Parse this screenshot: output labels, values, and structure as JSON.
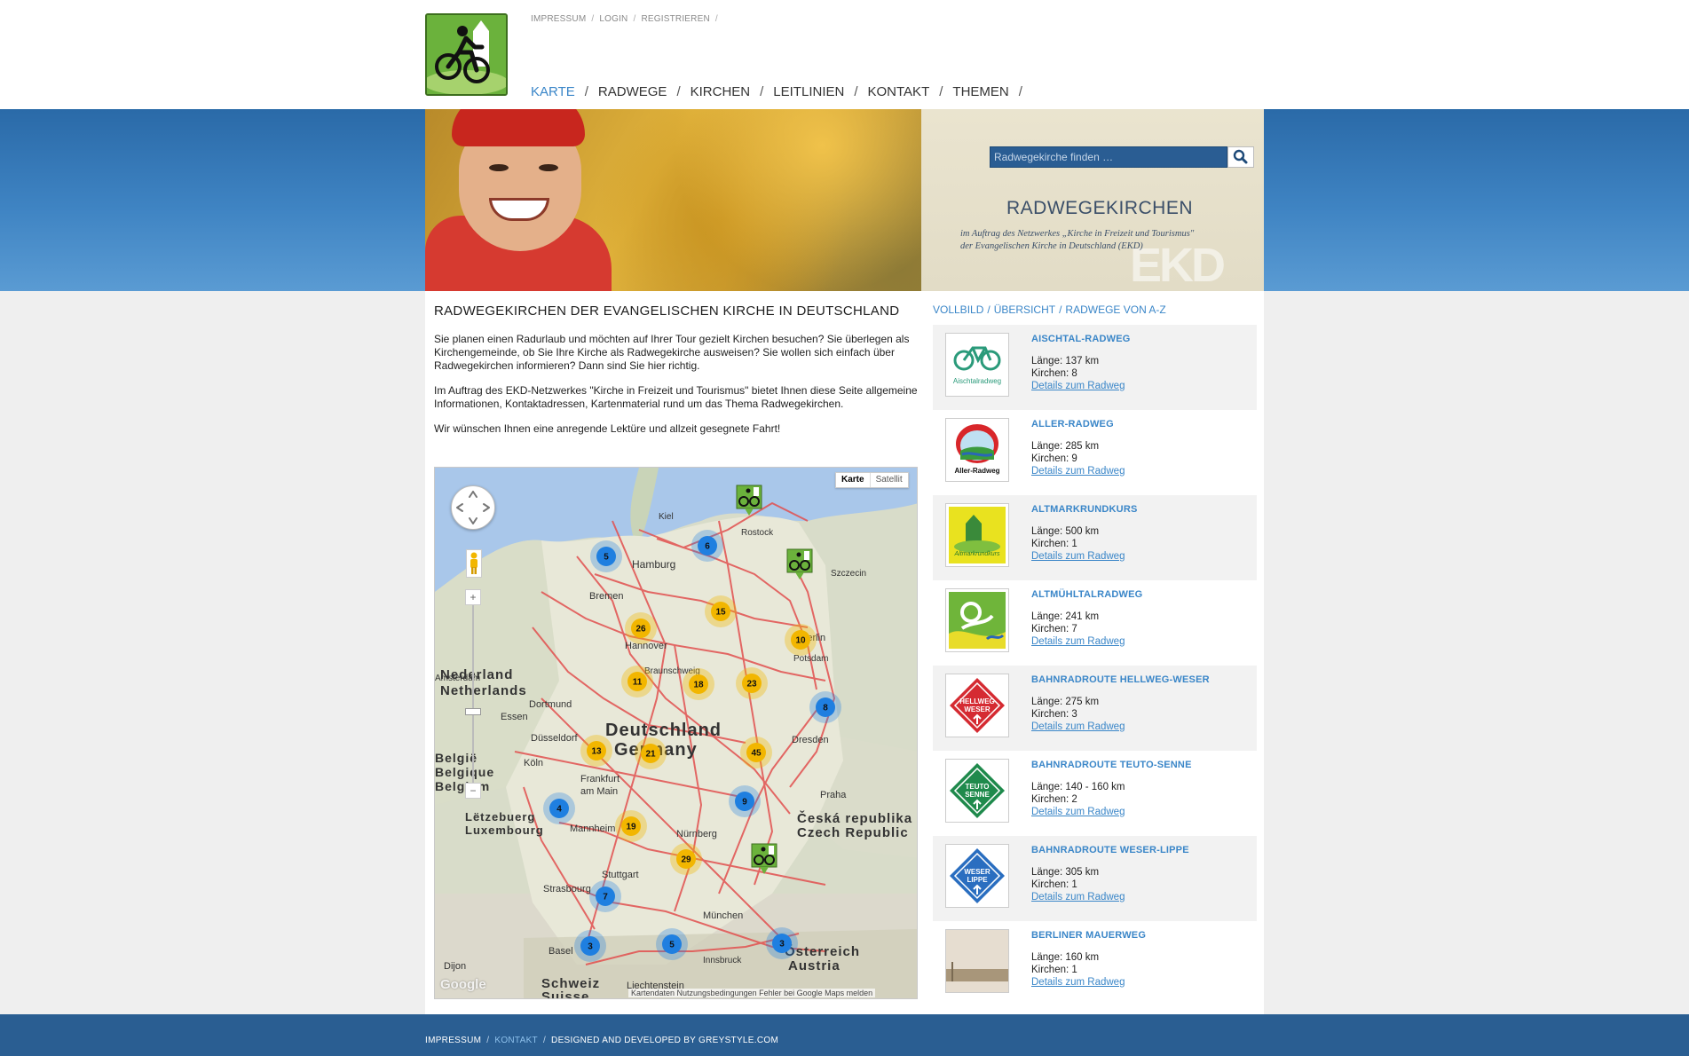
{
  "topnav": {
    "items": [
      {
        "label": "IMPRESSUM"
      },
      {
        "label": "LOGIN"
      },
      {
        "label": "REGISTRIEREN"
      }
    ],
    "separator": "/"
  },
  "mainnav": {
    "items": [
      {
        "label": "KARTE",
        "active": true
      },
      {
        "label": "RADWEGE"
      },
      {
        "label": "KIRCHEN"
      },
      {
        "label": "LEITLINIEN"
      },
      {
        "label": "KONTAKT"
      },
      {
        "label": "THEMEN"
      }
    ],
    "separator": "/"
  },
  "banner": {
    "search_placeholder": "Radwegekirche finden …",
    "title": "RADWEGEKIRCHEN",
    "subtitle_line1": "im Auftrag des Netzwerkes „Kirche in Freizeit und Tourismus\"",
    "subtitle_line2": "der Evangelischen Kirche in Deutschland (EKD)",
    "watermark": "EKD"
  },
  "intro": {
    "heading": "RADWEGEKIRCHEN DER EVANGELISCHEN KIRCHE IN DEUTSCHLAND",
    "p1": "Sie planen einen Radurlaub und möchten auf Ihrer Tour gezielt Kirchen besuchen? Sie überlegen als Kirchengemeinde, ob Sie Ihre Kirche als Radwegekirche ausweisen? Sie wollen sich einfach über Radwegekirchen informieren? Dann sind Sie hier richtig.",
    "p2": "Im Auftrag des EKD-Netzwerkes \"Kirche in Freizeit und Tourismus\" bietet Ihnen diese Seite allgemeine Informationen, Kontaktadressen, Kartenmaterial rund um das Thema Radwegekirchen.",
    "p3": "Wir wünschen Ihnen eine anregende Lektüre und allzeit gesegnete Fahrt!"
  },
  "map": {
    "type_buttons": {
      "karte": "Karte",
      "satellit": "Satellit"
    },
    "zoom_in": "+",
    "zoom_out": "−",
    "google": "Google",
    "footer": "Kartendaten   Nutzungsbedingungen   Fehler bei Google Maps melden",
    "labels": [
      {
        "text": "Kiel"
      },
      {
        "text": "Rostock"
      },
      {
        "text": "Hamburg"
      },
      {
        "text": "Szczecin"
      },
      {
        "text": "Bremen"
      },
      {
        "text": "Hannover"
      },
      {
        "text": "Berlin"
      },
      {
        "text": "Potsdam"
      },
      {
        "text": "Braunschweig"
      },
      {
        "text": "Nederland"
      },
      {
        "text": "Netherlands"
      },
      {
        "text": "Dortmund"
      },
      {
        "text": "Essen"
      },
      {
        "text": "Düsseldorf"
      },
      {
        "text": "Deutschland"
      },
      {
        "text": "Germany"
      },
      {
        "text": "Dresden"
      },
      {
        "text": "Köln"
      },
      {
        "text": "België"
      },
      {
        "text": "Belgique"
      },
      {
        "text": "Belgium"
      },
      {
        "text": "Frankfurt"
      },
      {
        "text": "am Main"
      },
      {
        "text": "Praha"
      },
      {
        "text": "Lëtzebuerg"
      },
      {
        "text": "Luxembourg"
      },
      {
        "text": "Mannheim"
      },
      {
        "text": "Nürnberg"
      },
      {
        "text": "Česká republika"
      },
      {
        "text": "Czech Republic"
      },
      {
        "text": "Strasbourg"
      },
      {
        "text": "Stuttgart"
      },
      {
        "text": "München"
      },
      {
        "text": "Basel"
      },
      {
        "text": "Innsbruck"
      },
      {
        "text": "Österreich"
      },
      {
        "text": "Austria"
      },
      {
        "text": "Dijon"
      },
      {
        "text": "Schweiz"
      },
      {
        "text": "Suisse"
      },
      {
        "text": "Liechtenstein"
      },
      {
        "text": "Amsterdam"
      }
    ],
    "clusters_blue": [
      5,
      6,
      8,
      4,
      9,
      7,
      3,
      5,
      3
    ],
    "clusters_orange": [
      26,
      15,
      10,
      11,
      18,
      23,
      13,
      21,
      45,
      19,
      29
    ]
  },
  "crumbs": {
    "items": [
      {
        "label": "VOLLBILD"
      },
      {
        "label": "ÜBERSICHT"
      },
      {
        "label": "RADWEGE VON A-Z"
      }
    ],
    "separator": "/"
  },
  "routes": [
    {
      "name": "AISCHTAL-RADWEG",
      "laenge": "Länge: 137 km",
      "kirchen": "Kirchen: 8",
      "link": "Details zum Radweg",
      "logo_text": "Aischtalradweg"
    },
    {
      "name": "ALLER-RADWEG",
      "laenge": "Länge: 285 km",
      "kirchen": "Kirchen: 9",
      "link": "Details zum Radweg",
      "logo_text": "Aller-Radweg"
    },
    {
      "name": "ALTMARKRUNDKURS",
      "laenge": "Länge: 500 km",
      "kirchen": "Kirchen: 1",
      "link": "Details zum Radweg",
      "logo_text": "Altmarkrundkurs"
    },
    {
      "name": "ALTMÜHLTALRADWEG",
      "laenge": "Länge: 241 km",
      "kirchen": "Kirchen: 7",
      "link": "Details zum Radweg",
      "logo_text": ""
    },
    {
      "name": "BAHNRADROUTE HELLWEG-WESER",
      "laenge": "Länge: 275 km",
      "kirchen": "Kirchen: 3",
      "link": "Details zum Radweg",
      "logo_text": "HELLWEG WESER"
    },
    {
      "name": "BAHNRADROUTE TEUTO-SENNE",
      "laenge": "Länge: 140 - 160 km",
      "kirchen": "Kirchen: 2",
      "link": "Details zum Radweg",
      "logo_text": "TEUTO SENNE"
    },
    {
      "name": "BAHNRADROUTE WESER-LIPPE",
      "laenge": "Länge: 305 km",
      "kirchen": "Kirchen: 1",
      "link": "Details zum Radweg",
      "logo_text": "WESER LIPPE"
    },
    {
      "name": "BERLINER MAUERWEG",
      "laenge": "Länge: 160 km",
      "kirchen": "Kirchen: 1",
      "link": "Details zum Radweg",
      "logo_text": ""
    }
  ],
  "footer": {
    "items": [
      {
        "label": "IMPRESSUM"
      },
      {
        "label": "KONTAKT",
        "active": true
      }
    ],
    "credit": "DESIGNED AND DEVELOPED BY GREYSTYLE.COM",
    "separator": "/"
  },
  "colors": {
    "accent_blue": "#3a86c8",
    "banner_blue": "#3f84c3",
    "footer_blue": "#2a5e92",
    "logo_green": "#6bb23c",
    "cluster_blue": "#1f7fe0",
    "cluster_orange": "#f2b600",
    "route_red": "#e2504f"
  },
  "icons": {
    "logo": "bicycle-church-logo-icon",
    "search": "magnifier-icon",
    "pan": "pan-arrows-icon",
    "pegman": "pegman-icon"
  }
}
